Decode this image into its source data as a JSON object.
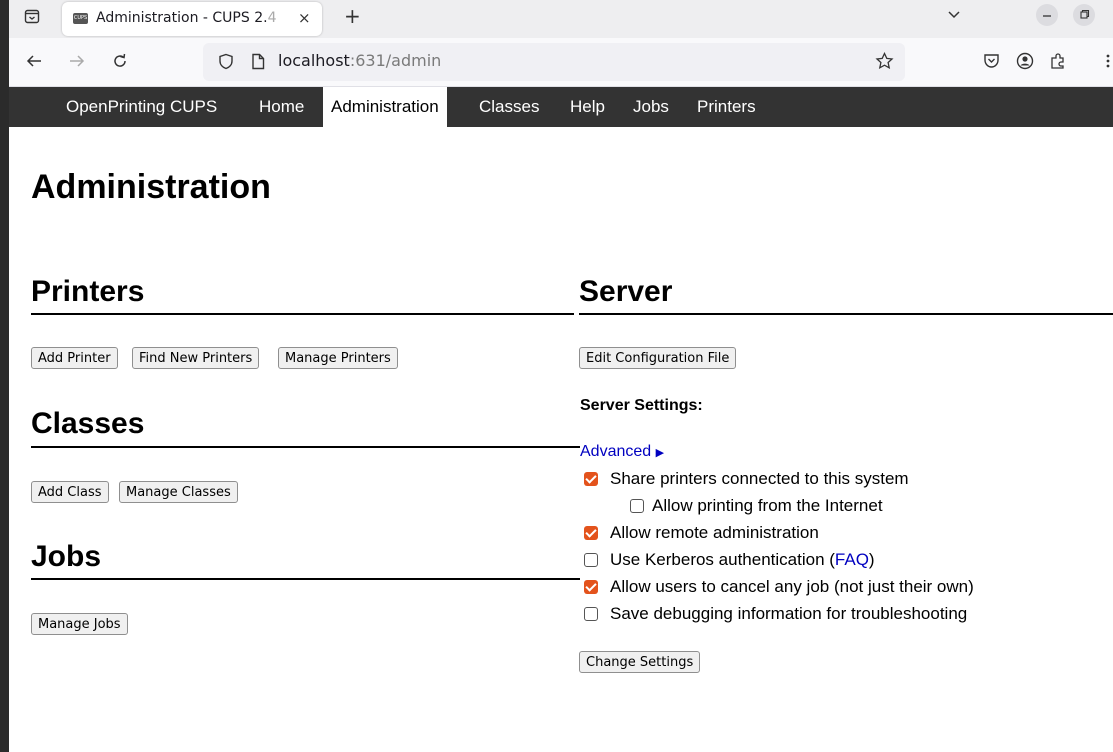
{
  "browser": {
    "tab": {
      "favicon": "CUPS",
      "title": "Administration - CUPS 2.",
      "title_fade": "4",
      "close": "×"
    },
    "new_tab": "+",
    "url_host": "localhost",
    "url_rest": ":631/admin",
    "icons": [
      "tab-list-icon",
      "back-arrow-icon",
      "forward-arrow-icon",
      "reload-icon",
      "shield-icon",
      "page-icon",
      "star-icon",
      "pocket-icon",
      "account-icon",
      "extensions-icon",
      "overflow-menu-icon",
      "chevron-down-icon",
      "minimize-icon",
      "restore-icon"
    ]
  },
  "nav": {
    "brand": "OpenPrinting CUPS",
    "items": [
      "Home",
      "Administration",
      "Classes",
      "Help",
      "Jobs",
      "Printers"
    ],
    "active": "Administration"
  },
  "page_title": "Administration",
  "printers": {
    "heading": "Printers",
    "buttons": [
      "Add Printer",
      "Find New Printers",
      "Manage Printers"
    ]
  },
  "classes": {
    "heading": "Classes",
    "buttons": [
      "Add Class",
      "Manage Classes"
    ]
  },
  "jobs": {
    "heading": "Jobs",
    "buttons": [
      "Manage Jobs"
    ]
  },
  "server": {
    "heading": "Server",
    "edit_button": "Edit Configuration File",
    "settings_heading": "Server Settings:",
    "advanced_link": "Advanced",
    "advanced_arrow": "▶",
    "options": [
      {
        "label": "Share printers connected to this system",
        "checked": true
      },
      {
        "label": "Allow printing from the Internet",
        "checked": false
      },
      {
        "label": "Allow remote administration",
        "checked": true
      },
      {
        "label": "Use Kerberos authentication (",
        "link": "FAQ",
        "suffix": ")",
        "checked": false
      },
      {
        "label": "Allow users to cancel any job (not just their own)",
        "checked": true
      },
      {
        "label": "Save debugging information for troubleshooting",
        "checked": false
      }
    ],
    "change_button": "Change Settings"
  },
  "colors": {
    "nav_bg": "#333333",
    "checkbox_on": "#e3531c",
    "link": "#0000c0"
  }
}
